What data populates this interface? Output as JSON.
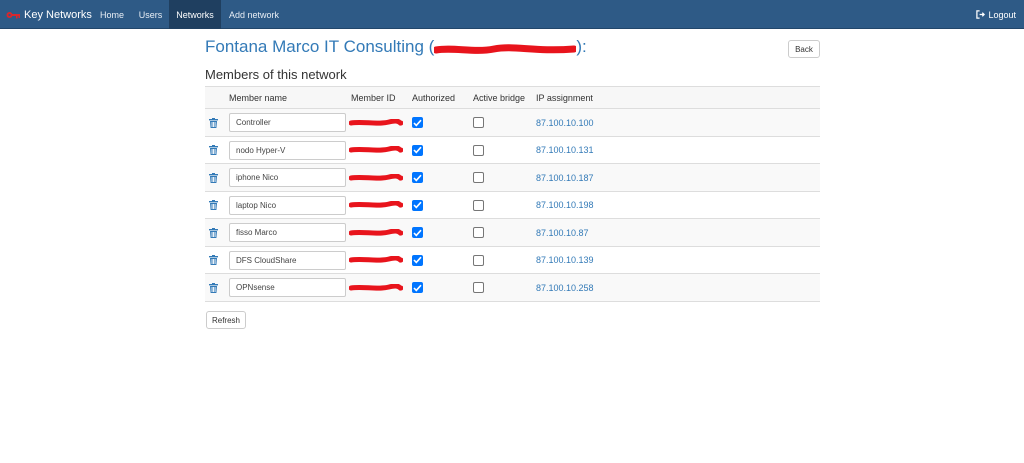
{
  "navbar": {
    "brand": "Key Networks",
    "items": [
      {
        "label": "Home",
        "active": false
      },
      {
        "label": "Users",
        "active": false
      },
      {
        "label": "Networks",
        "active": true
      },
      {
        "label": "Add network",
        "active": false
      }
    ],
    "logout": "Logout",
    "brand_color": "#d9262c"
  },
  "header": {
    "title": "Fontana Marco IT Consulting",
    "title_open": "(",
    "title_close": "):",
    "back_label": "Back",
    "section_title": "Members of this network"
  },
  "table": {
    "columns": [
      "Member name",
      "Member ID",
      "Authorized",
      "Active bridge",
      "IP assignment"
    ],
    "rows": [
      {
        "name": "Controller",
        "authorized": true,
        "active_bridge": false,
        "ip": "87.100.10.100"
      },
      {
        "name": "nodo Hyper-V",
        "authorized": true,
        "active_bridge": false,
        "ip": "87.100.10.131"
      },
      {
        "name": "iphone Nico",
        "authorized": true,
        "active_bridge": false,
        "ip": "87.100.10.187"
      },
      {
        "name": "laptop Nico",
        "authorized": true,
        "active_bridge": false,
        "ip": "87.100.10.198"
      },
      {
        "name": "fisso Marco",
        "authorized": true,
        "active_bridge": false,
        "ip": "87.100.10.87"
      },
      {
        "name": "DFS CloudShare",
        "authorized": true,
        "active_bridge": false,
        "ip": "87.100.10.139"
      },
      {
        "name": "OPNsense",
        "authorized": true,
        "active_bridge": false,
        "ip": "87.100.10.258"
      }
    ]
  },
  "footer": {
    "refresh_label": "Refresh"
  },
  "colors": {
    "navbar": "#2e5a86",
    "link": "#337ab7",
    "redaction": "#e8141c",
    "checkbox": "#0075ff"
  }
}
